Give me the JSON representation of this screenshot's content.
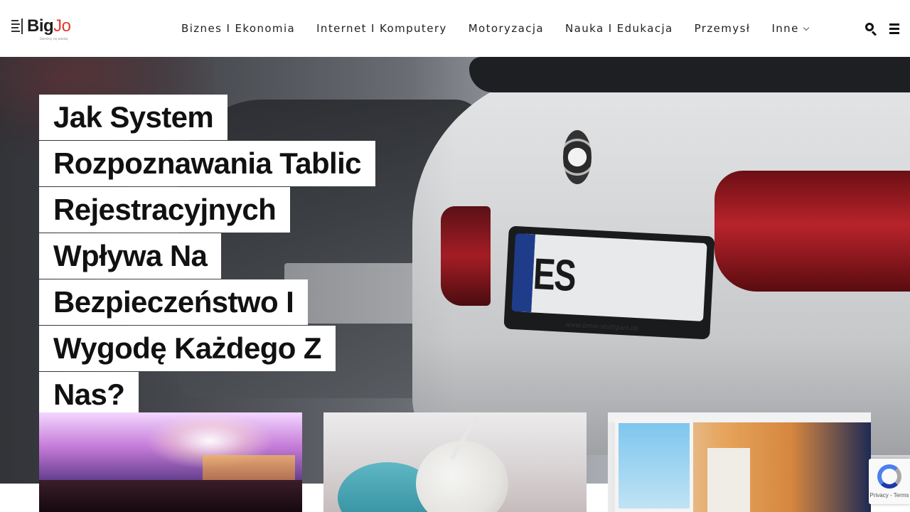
{
  "header": {
    "logo": {
      "word_main": "Big",
      "word_accent": "Jo",
      "tagline": "Dzielimy się wiedzą"
    },
    "nav": [
      {
        "label": "Biznes I Ekonomia"
      },
      {
        "label": "Internet I Komputery"
      },
      {
        "label": "Motoryzacja"
      },
      {
        "label": "Nauka I Edukacja"
      },
      {
        "label": "Przemysł"
      },
      {
        "label": "Inne",
        "has_dropdown": true
      }
    ],
    "icons": [
      "search-icon",
      "menu-icon"
    ]
  },
  "hero": {
    "title_lines": [
      "Jak System",
      "Rozpoznawania Tablic",
      "Rejestracyjnych",
      "Wpływa Na",
      "Bezpieczeństwo I",
      "Wygodę Każdego Z",
      "Nas?"
    ],
    "plate_text": "ES",
    "plate_caption": "www.bmw-stuttgart.de"
  },
  "cards": [
    {
      "image": "concert-crowd"
    },
    {
      "image": "facial-treatment"
    },
    {
      "image": "kitchen-interior"
    }
  ],
  "recaptcha": {
    "terms": "Privacy - Terms"
  },
  "colors": {
    "accent": "#e03a2e",
    "text": "#222222",
    "title_bg": "#ffffff"
  }
}
